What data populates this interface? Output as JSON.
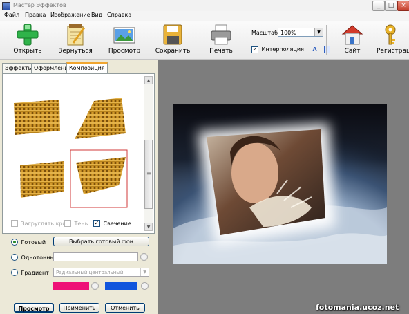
{
  "window": {
    "title": "Мастер Эффектов"
  },
  "menu": [
    "Файл",
    "Правка",
    "Изображение",
    "Вид",
    "Справка"
  ],
  "toolbar": {
    "open": "Открыть",
    "undo": "Вернуться",
    "view": "Просмотр",
    "save": "Сохранить",
    "print": "Печать",
    "zoom_label": "Масштаб",
    "zoom_value": "100%",
    "interpolation_label": "Интерполяция",
    "site": "Сайт",
    "register": "Регистрац"
  },
  "tabs": [
    "Эффекты",
    "Оформление",
    "Композиция"
  ],
  "options": {
    "round_edges": "Загруглять края",
    "shadow": "Тень",
    "glow": "Свечение"
  },
  "background": {
    "ready_label": "Готовый",
    "choose_button": "Выбрать готовый фон",
    "solid_label": "Однотонный",
    "gradient_label": "Градиент",
    "gradient_type": "Радиальный центральный",
    "color1": "#ee1177",
    "color2": "#1155dd"
  },
  "buttons": {
    "preview": "Просмотр",
    "apply": "Применить",
    "cancel": "Отменить"
  },
  "watermark": "fotomania.ucoz.net"
}
